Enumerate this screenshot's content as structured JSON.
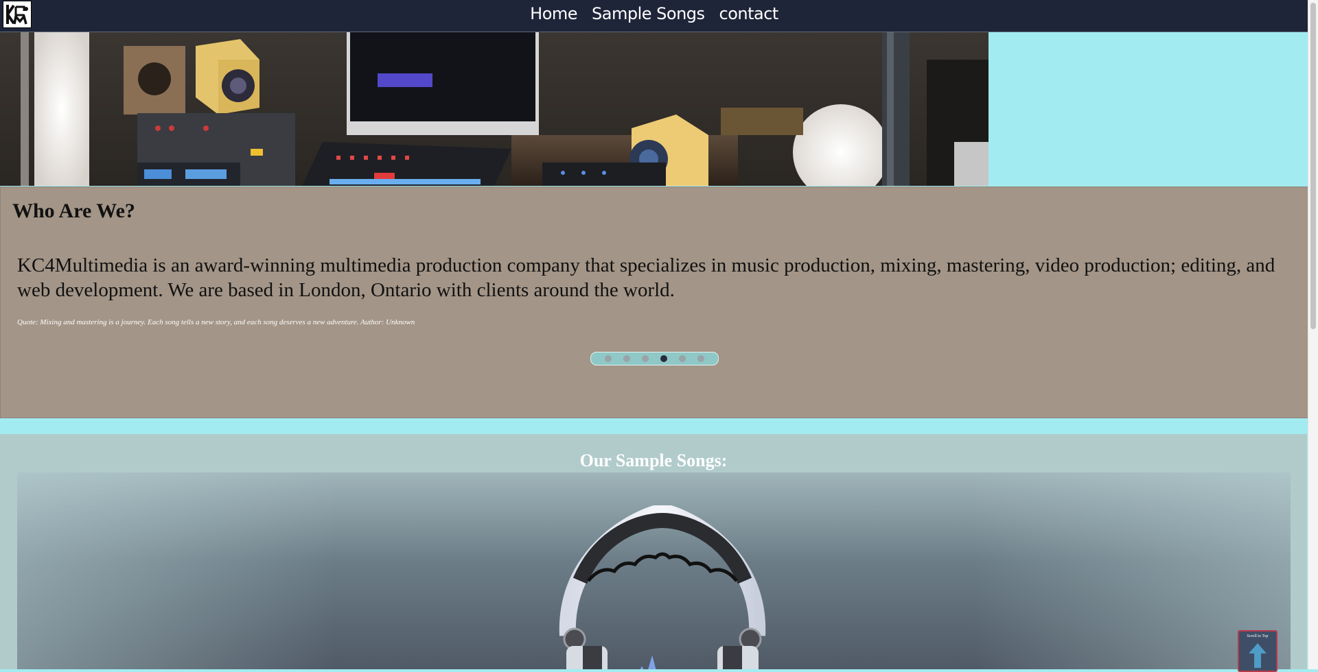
{
  "nav": {
    "logo_alt": "KC4M",
    "links": [
      "Home",
      "Sample Songs",
      "contact"
    ]
  },
  "hero": {
    "image": "studio-desk-image"
  },
  "about": {
    "heading": "Who Are We?",
    "description": "KC4Multimedia is an award-winning multimedia production company that specializes in music production, mixing, mastering, video production; editing, and web development. We are based in London, Ontario with clients around the world.",
    "quote": "Quote: Mixing and mastering is a journey. Each song tells a new story, and each song deserves a new adventure. Author: Unknown",
    "carousel": {
      "count": 6,
      "active_index": 3
    }
  },
  "songs": {
    "heading": "Our Sample Songs:",
    "image": "headphones-icon"
  },
  "scroll_top": {
    "label": "Scroll to Top"
  },
  "colors": {
    "nav_bg": "#1f2539",
    "page_bg": "#a2ecf1",
    "about_bg": "#a39587",
    "dots_bg": "#8fc8c6",
    "scroll_top_border": "#b93a4c"
  }
}
